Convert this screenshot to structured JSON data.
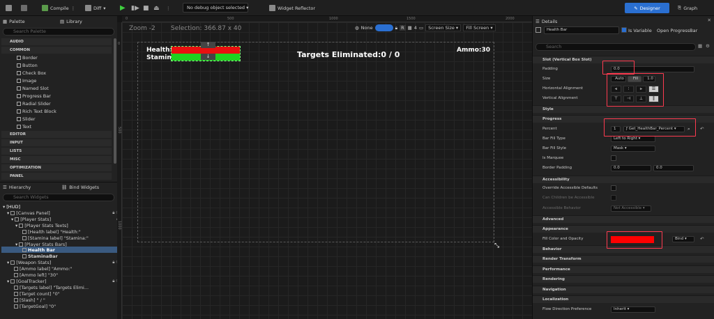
{
  "toolbar": {
    "compile": "Compile",
    "diff": "Diff",
    "debug_select": "No debug object selected",
    "reflector": "Widget Reflector",
    "designer": "Designer",
    "graph": "Graph"
  },
  "palette": {
    "title": "Palette",
    "library": "Library",
    "search_placeholder": "Search Palette",
    "categories": [
      "AUDIO",
      "COMMON",
      "EDITOR",
      "INPUT",
      "LISTS",
      "MISC",
      "OPTIMIZATION",
      "PANEL"
    ],
    "common_items": [
      "Border",
      "Button",
      "Check Box",
      "Image",
      "Named Slot",
      "Progress Bar",
      "Radial Slider",
      "Rich Text Block",
      "Slider",
      "Text"
    ]
  },
  "hierarchy": {
    "title": "Hierarchy",
    "bind": "Bind Widgets",
    "search_placeholder": "Search Widgets",
    "rows": [
      "[HUD]",
      "[Canvas Panel]",
      "[Player Stats]",
      "[Player Stats Texts]",
      "[Health label] \"Health:\"",
      "[Stamina label] \"Stamina:\"",
      "[Player Stats Bars]",
      "Health Bar",
      "StaminaBar",
      "[Weapon Stats]",
      "[Ammo label] \"Ammo:\"",
      "[Ammo left] \"30\"",
      "[GoalTracker]",
      "[Targets label] \"Targets Elimi...",
      "[Target count] \"0\"",
      "[Slash] \" / \"",
      "[TargetGoal] \"0\""
    ]
  },
  "canvas": {
    "zoom": "Zoom -2",
    "selection": "Selection: 366.87 x 40",
    "none_label": "None",
    "r_label": "R",
    "grid_num": "4",
    "screen_size": "Screen Size",
    "fill_screen": "Fill Screen",
    "ruler_h": [
      "0",
      "500",
      "1000",
      "1500",
      "2000"
    ],
    "ruler_v": [
      "0",
      "500",
      "1000"
    ],
    "hud_health": "Health:",
    "hud_stamina": "Stamina:",
    "hud_targets": "Targets Eliminated:0 / 0",
    "hud_ammo": "Ammo:30"
  },
  "details": {
    "title": "Details",
    "widget_name": "Health Bar",
    "is_variable": "Is Variable",
    "open_link": "Open ProgressBar",
    "search_placeholder": "Search",
    "slot_section": "Slot (Vertical Box Slot)",
    "padding_label": "Padding",
    "padding_value": "0.0",
    "size_label": "Size",
    "size_auto": "Auto",
    "size_fill": "Fill",
    "size_value": "1.0",
    "halign_label": "Horizontal Alignment",
    "valign_label": "Vertical Alignment",
    "style_section": "Style",
    "progress_section": "Progress",
    "percent_label": "Percent",
    "percent_value": "1",
    "percent_binding": "Get_HealthBar_Percent",
    "fill_type_label": "Bar Fill Type",
    "fill_type_value": "Left to Right",
    "fill_style_label": "Bar Fill Style",
    "fill_style_value": "Mask",
    "marquee_label": "Is Marquee",
    "border_padding_label": "Border Padding",
    "bp_x": "0.0",
    "bp_y": "0.0",
    "accessibility_section": "Accessibility",
    "override_label": "Override Accessible Defaults",
    "children_label": "Can Children be Accessible",
    "behavior_label": "Accessible Behavior",
    "behavior_value": "Not Accessible",
    "advanced_section": "Advanced",
    "appearance_section": "Appearance",
    "fill_color_label": "Fill Color and Opacity",
    "fill_color": "#ff0000",
    "bind_label": "Bind",
    "sections_rest": [
      "Behavior",
      "Render Transform",
      "Performance",
      "Rendering",
      "Navigation",
      "Localization"
    ],
    "flow_label": "Flow Direction Preference",
    "flow_value": "Inherit"
  },
  "colors": {
    "accent": "#2a6fd1",
    "highlight": "#ff3b50",
    "health": "#e81010",
    "stamina": "#1fd21f"
  }
}
